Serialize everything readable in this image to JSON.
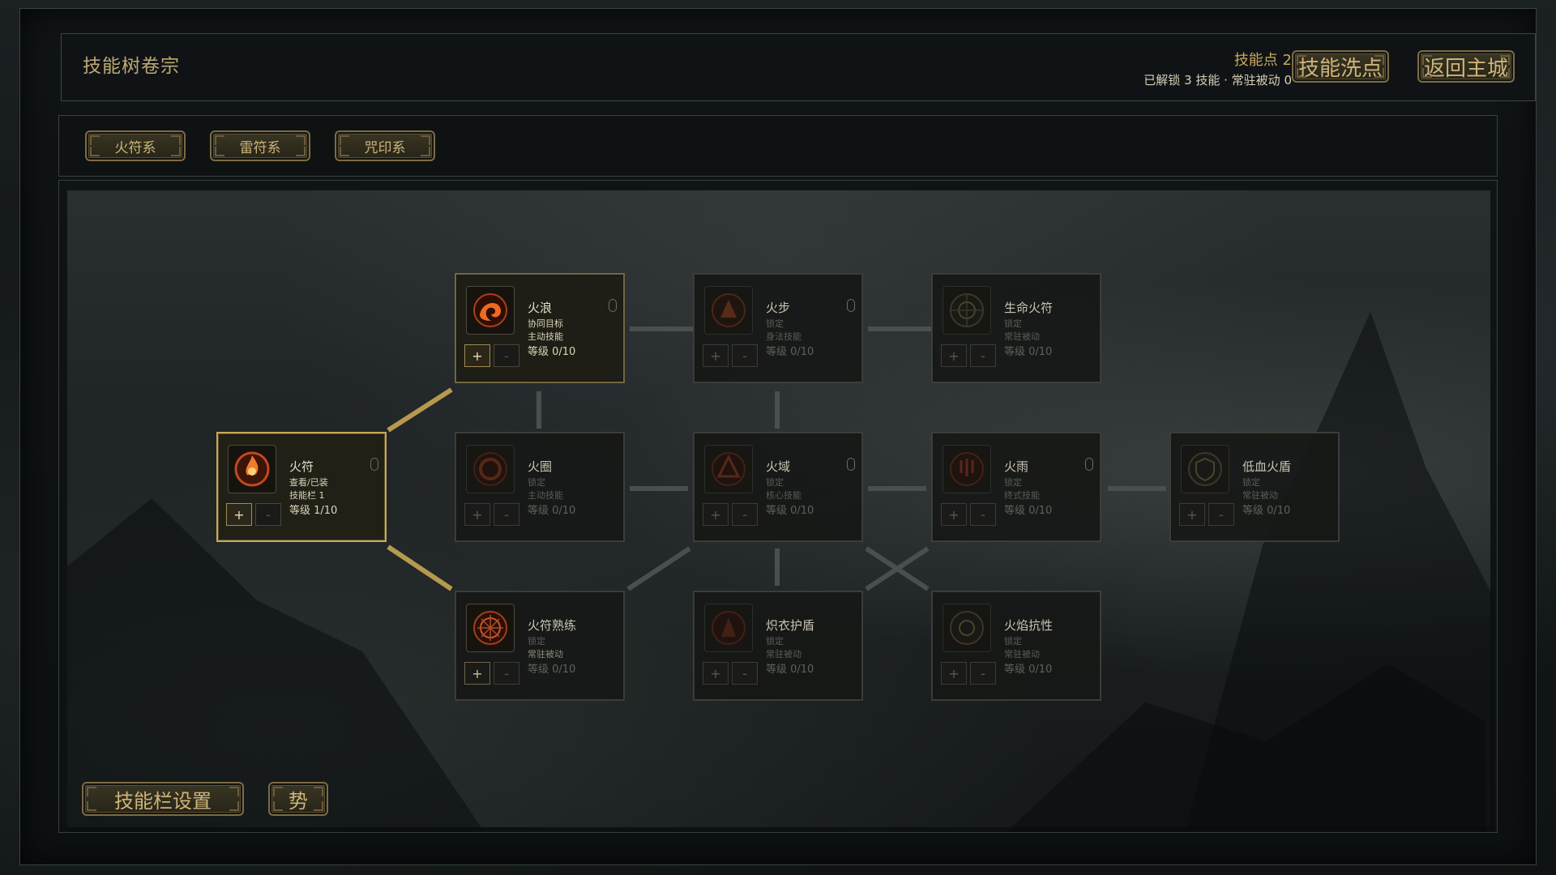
{
  "header": {
    "title": "技能树卷宗",
    "skill_points_label": "技能点 2",
    "summary": "已解锁 3 技能 · 常驻被动 0",
    "reset_label": "技能洗点",
    "return_label": "返回主城"
  },
  "tabs": [
    {
      "label": "火符系"
    },
    {
      "label": "雷符系"
    },
    {
      "label": "咒印系"
    }
  ],
  "nodes": {
    "huofu": {
      "name": "火符",
      "sub1": "查看/已装",
      "sub2": "技能栏 1",
      "level": "等级 1/10",
      "icon": "fire-talisman-icon"
    },
    "huolang": {
      "name": "火浪",
      "sub1": "协同目标",
      "sub2": "主动技能",
      "level": "等级 0/10",
      "icon": "fire-wave-icon"
    },
    "huobu": {
      "name": "火步",
      "sub1": "锁定",
      "sub2": "身法技能",
      "level": "等级 0/10",
      "icon": "fire-step-icon"
    },
    "shengming": {
      "name": "生命火符",
      "sub1": "锁定",
      "sub2": "常驻被动",
      "level": "等级 0/10",
      "icon": "life-fire-icon"
    },
    "huoquan": {
      "name": "火圈",
      "sub1": "锁定",
      "sub2": "主动技能",
      "level": "等级 0/10",
      "icon": "fire-ring-icon"
    },
    "huoyu_domain": {
      "name": "火域",
      "sub1": "锁定",
      "sub2": "核心技能",
      "level": "等级 0/10",
      "icon": "fire-domain-icon"
    },
    "huoyu_rain": {
      "name": "火雨",
      "sub1": "锁定",
      "sub2": "终式技能",
      "level": "等级 0/10",
      "icon": "fire-rain-icon"
    },
    "dixue": {
      "name": "低血火盾",
      "sub1": "锁定",
      "sub2": "常驻被动",
      "level": "等级 0/10",
      "icon": "low-hp-shield-icon"
    },
    "shulian": {
      "name": "火符熟练",
      "sub1": "锁定",
      "sub2": "常驻被动",
      "level": "等级 0/10",
      "icon": "mastery-icon"
    },
    "huyi": {
      "name": "炽衣护盾",
      "sub1": "锁定",
      "sub2": "常驻被动",
      "level": "等级 0/10",
      "icon": "robe-shield-icon"
    },
    "kangxing": {
      "name": "火焰抗性",
      "sub1": "锁定",
      "sub2": "常驻被动",
      "level": "等级 0/10",
      "icon": "fire-resist-icon"
    }
  },
  "controls": {
    "plus": "+",
    "minus": "-"
  },
  "bottom": {
    "skillbar_label": "技能栏设置",
    "stance_label": "势"
  },
  "colors": {
    "accent": "#c7a957",
    "active_link": "#b59a4e",
    "inactive_link": "#4a4f4e"
  }
}
